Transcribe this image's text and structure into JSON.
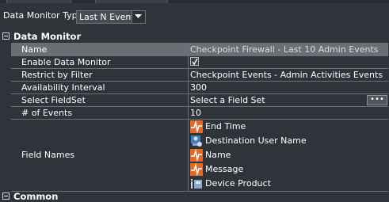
{
  "toolbar": {
    "label": "Data Monitor Type",
    "select_value": "Last N Events"
  },
  "sections": {
    "data_monitor": "Data Monitor",
    "common": "Common"
  },
  "rows": [
    {
      "key": "Name",
      "value": "Checkpoint Firewall - Last 10 Admin Events"
    },
    {
      "key": "Enable Data Monitor",
      "value": ""
    },
    {
      "key": "Restrict by Filter",
      "value": "Checkpoint Events - Admin Activities Events"
    },
    {
      "key": "Availability Interval",
      "value": "300"
    },
    {
      "key": "Select FieldSet",
      "value": "Select a Field Set",
      "button": "•••"
    },
    {
      "key": "# of Events",
      "value": "10"
    }
  ],
  "field_names": {
    "key": "Field Names",
    "items": [
      {
        "label": "End Time",
        "icon": "event-field-icon"
      },
      {
        "label": "Destination User Name",
        "icon": "user-field-icon"
      },
      {
        "label": "Name",
        "icon": "event-field-icon"
      },
      {
        "label": "Message",
        "icon": "event-field-icon"
      },
      {
        "label": "Device Product",
        "icon": "device-field-icon"
      }
    ]
  },
  "enable_checked": true,
  "colors": {
    "background": "#2e3439",
    "selected_row": "#6b6f73",
    "required_marker": "#d01c1c",
    "field_icon": "#e06a2a"
  }
}
